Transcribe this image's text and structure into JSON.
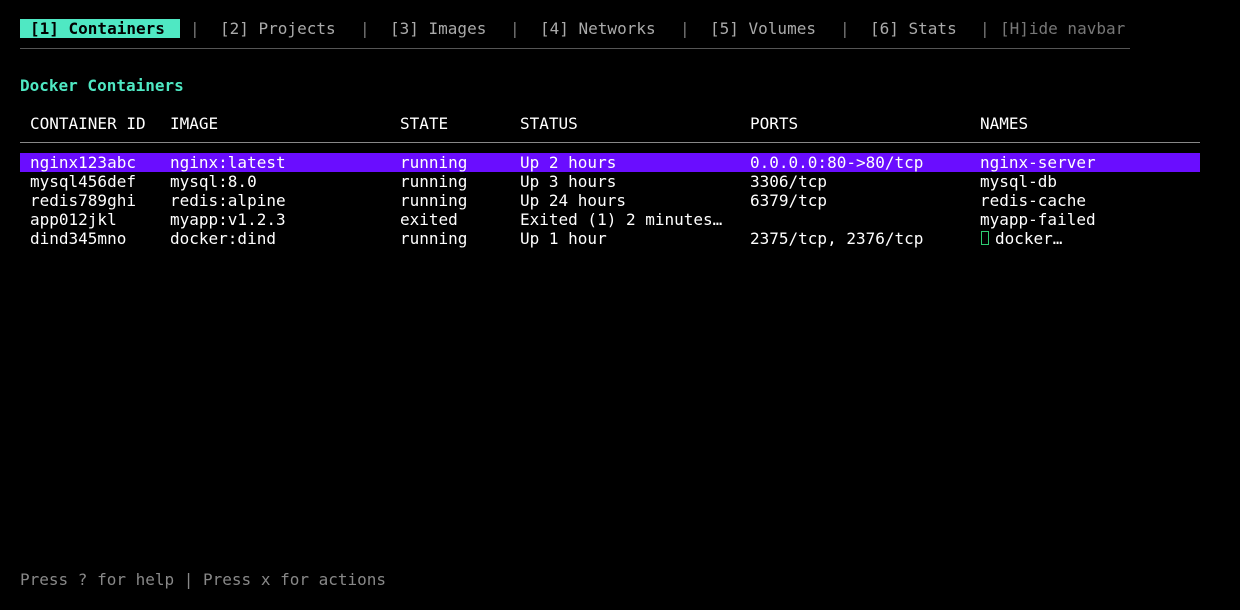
{
  "navbar": {
    "tabs": [
      {
        "label": "[1] Containers",
        "active": true
      },
      {
        "label": "[2] Projects",
        "active": false
      },
      {
        "label": "[3] Images",
        "active": false
      },
      {
        "label": "[4] Networks",
        "active": false
      },
      {
        "label": "[5] Volumes",
        "active": false
      },
      {
        "label": "[6] Stats",
        "active": false
      }
    ],
    "separator": "|",
    "hide_label": "[H]ide navbar"
  },
  "title": "Docker Containers",
  "table": {
    "columns": [
      "CONTAINER ID",
      "IMAGE",
      "STATE",
      "STATUS",
      "PORTS",
      "NAMES"
    ],
    "selected_row": 0,
    "rows": [
      {
        "id": "nginx123abc",
        "image": "nginx:latest",
        "state": "running",
        "status": "Up 2 hours",
        "ports": "0.0.0.0:80->80/tcp",
        "names": "nginx-server"
      },
      {
        "id": "mysql456def",
        "image": "mysql:8.0",
        "state": "running",
        "status": "Up 3 hours",
        "ports": "3306/tcp",
        "names": "mysql-db"
      },
      {
        "id": "redis789ghi",
        "image": "redis:alpine",
        "state": "running",
        "status": "Up 24 hours",
        "ports": "6379/tcp",
        "names": "redis-cache"
      },
      {
        "id": "app012jkl",
        "image": "myapp:v1.2.3",
        "state": "exited",
        "status": "Exited (1) 2 minutes…",
        "ports": "",
        "names": "myapp-failed"
      },
      {
        "id": "dind345mno",
        "image": "docker:dind",
        "state": "running",
        "status": "Up 1 hour",
        "ports": "2375/tcp, 2376/tcp",
        "names": "docker…",
        "names_icon": "missing-glyph-box-icon"
      }
    ]
  },
  "footer": "Press ? for help | Press x for actions",
  "colors": {
    "accent": "#4fe8c3",
    "selection": "#6a0dff",
    "background": "#000000"
  }
}
